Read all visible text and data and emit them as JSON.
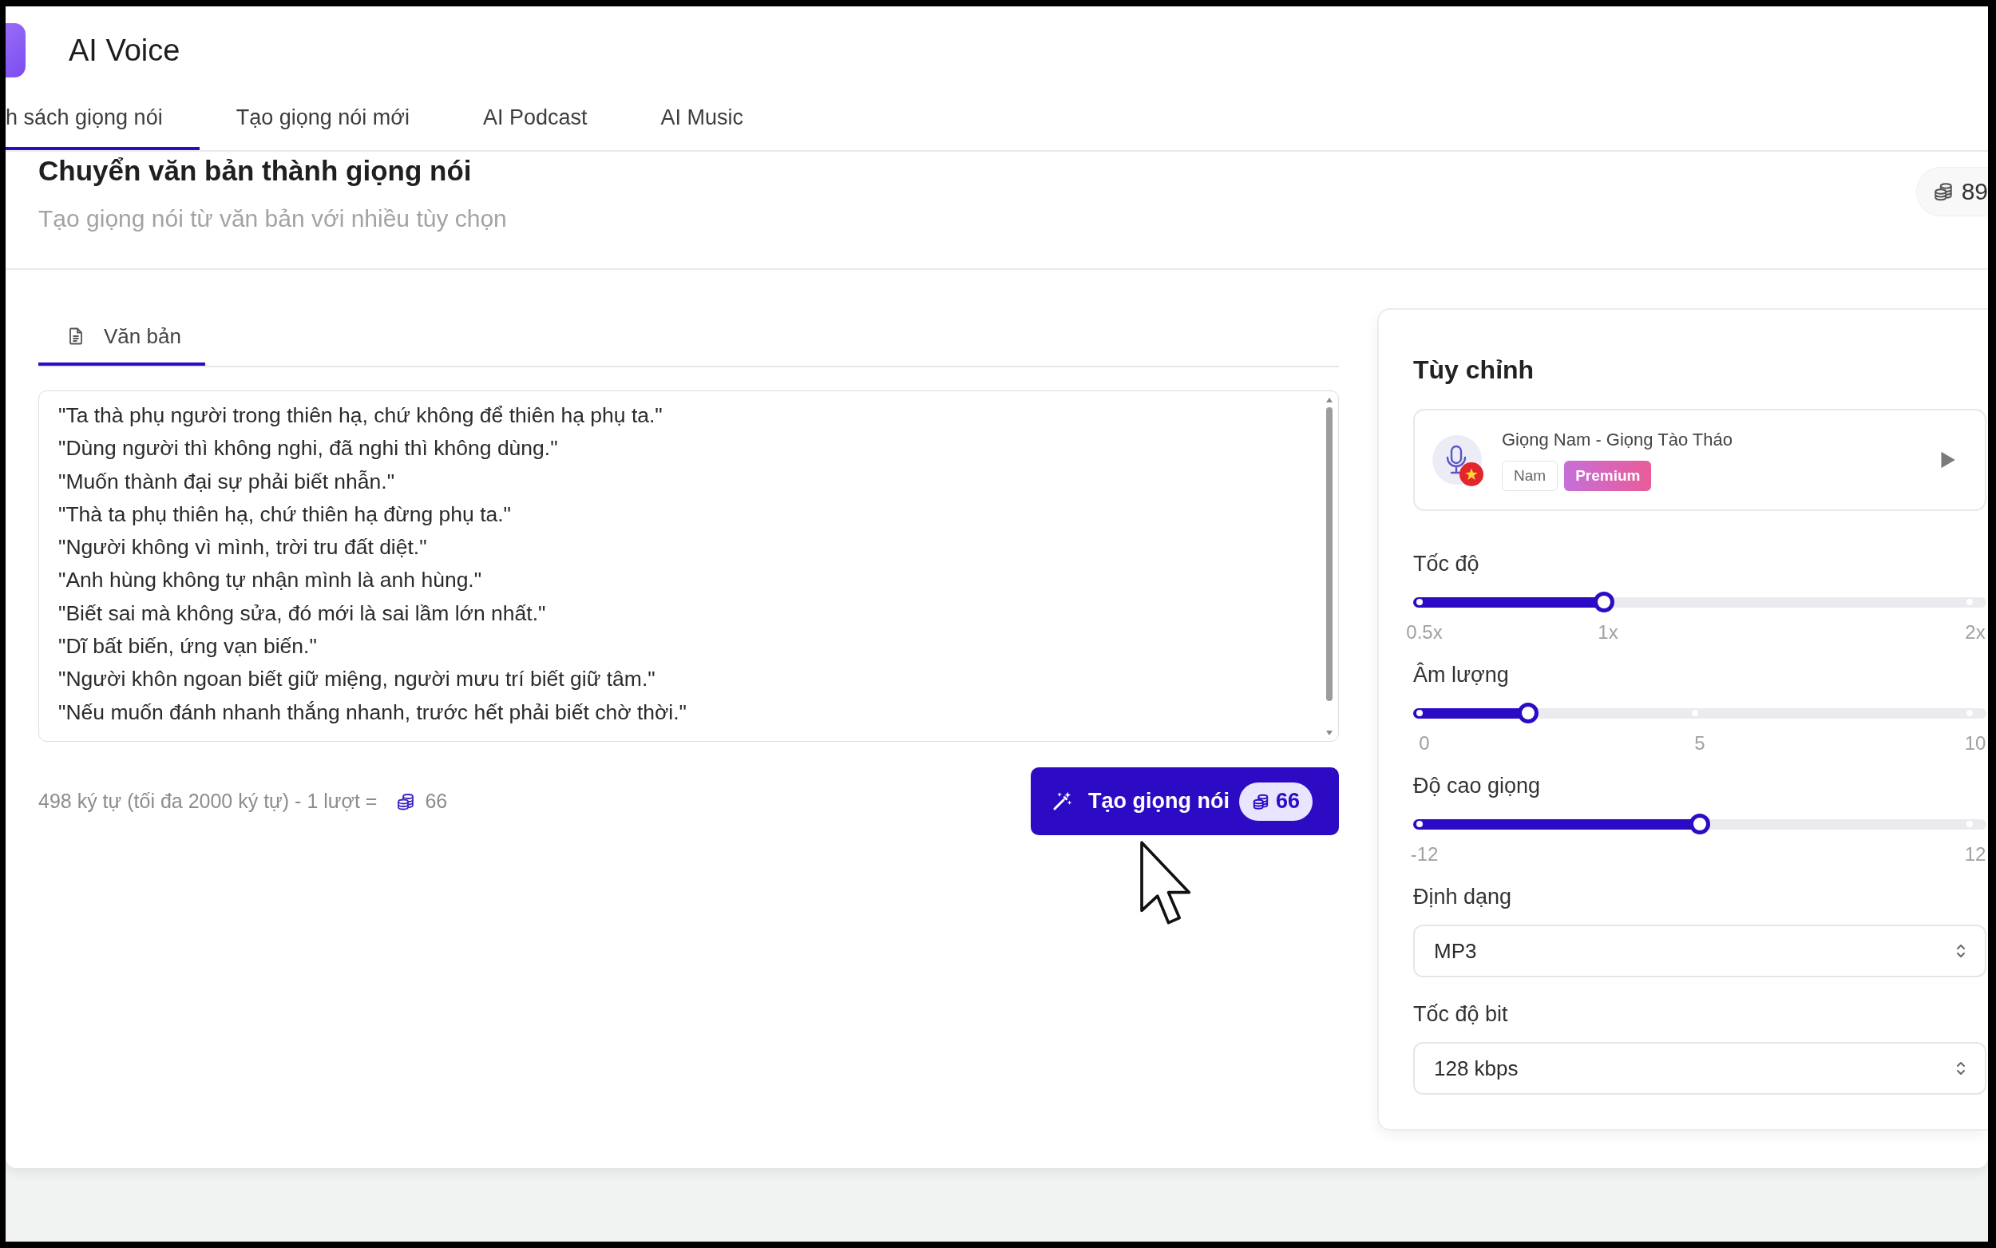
{
  "app": {
    "title": "AI Voice"
  },
  "tabs": [
    {
      "label": "h sách giọng nói",
      "selected": true
    },
    {
      "label": "Tạo giọng nói mới",
      "selected": false
    },
    {
      "label": "AI Podcast",
      "selected": false
    },
    {
      "label": "AI Music",
      "selected": false
    }
  ],
  "page_header": {
    "title": "Chuyển văn bản thành giọng nói",
    "subtitle": "Tạo giọng nói từ văn bản với nhiều tùy chọn",
    "credits": "89"
  },
  "editor": {
    "tabs": [
      {
        "label": "Văn bản",
        "selected": true
      }
    ],
    "lines": [
      "\"Ta thà phụ người trong thiên hạ, chứ không để thiên hạ phụ ta.\"",
      "\"Dùng người thì không nghi, đã nghi thì không dùng.\"",
      "\"Muốn thành đại sự phải biết nhẫn.\"",
      "\"Thà ta phụ thiên hạ, chứ thiên hạ đừng phụ ta.\"",
      "\"Người không vì mình, trời tru đất diệt.\"",
      "\"Anh hùng không tự nhận mình là anh hùng.\"",
      "\"Biết sai mà không sửa, đó mới là sai lầm lớn nhất.\"",
      "\"Dĩ bất biến, ứng vạn biến.\"",
      "\"Người khôn ngoan biết giữ miệng, người mưu trí biết giữ tâm.\"",
      "\"Nếu muốn đánh nhanh thắng nhanh, trước hết phải biết chờ thời.\""
    ],
    "char_count": "498 ký tự (tối đa 2000 ký tự) - 1 lượt =",
    "cost": "66",
    "generate_button": {
      "label": "Tạo giọng nói",
      "cost": "66"
    }
  },
  "settings": {
    "title": "Tùy chỉnh",
    "voice": {
      "name": "Giọng Nam - Giọng Tào Tháo",
      "tags": [
        {
          "label": "Nam",
          "kind": "plain"
        },
        {
          "label": "Premium",
          "kind": "premium"
        }
      ]
    },
    "sliders": [
      {
        "label": "Tốc độ",
        "level": 0.333,
        "ticks": [
          "0.5x",
          "1x",
          "2x"
        ]
      },
      {
        "label": "Âm lượng",
        "level": 0.2,
        "ticks": [
          "0",
          "5",
          "10"
        ]
      },
      {
        "label": "Độ cao giọng",
        "level": 0.5,
        "ticks": [
          "-12",
          "12"
        ]
      }
    ],
    "selects": [
      {
        "label": "Định dạng",
        "value": "MP3"
      },
      {
        "label": "Tốc độ bit",
        "value": "128 kbps"
      }
    ]
  }
}
